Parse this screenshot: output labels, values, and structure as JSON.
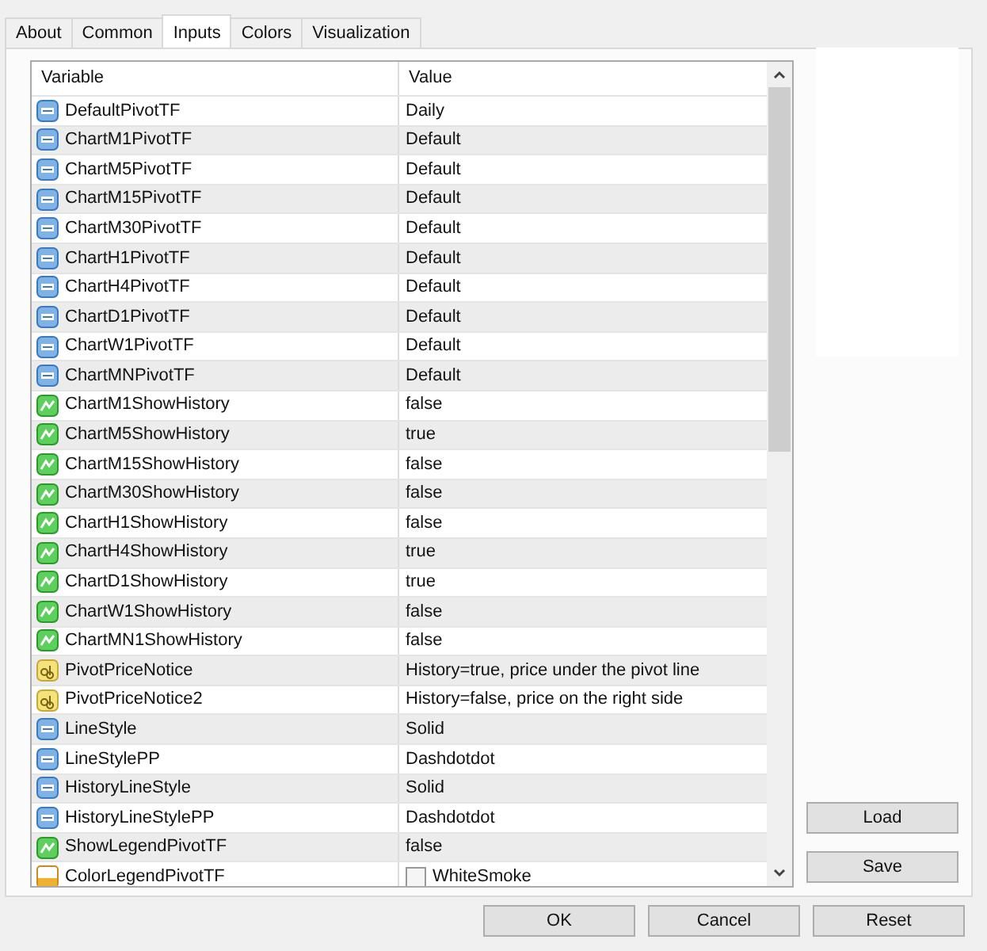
{
  "tabs": [
    {
      "label": "About",
      "selected": false
    },
    {
      "label": "Common",
      "selected": false
    },
    {
      "label": "Inputs",
      "selected": true
    },
    {
      "label": "Colors",
      "selected": false
    },
    {
      "label": "Visualization",
      "selected": false
    }
  ],
  "table": {
    "columns": [
      "Variable",
      "Value"
    ],
    "rows": [
      {
        "kind": "number",
        "variable": "DefaultPivotTF",
        "value": "Daily"
      },
      {
        "kind": "number",
        "variable": "ChartM1PivotTF",
        "value": "Default"
      },
      {
        "kind": "number",
        "variable": "ChartM5PivotTF",
        "value": "Default"
      },
      {
        "kind": "number",
        "variable": "ChartM15PivotTF",
        "value": "Default"
      },
      {
        "kind": "number",
        "variable": "ChartM30PivotTF",
        "value": "Default"
      },
      {
        "kind": "number",
        "variable": "ChartH1PivotTF",
        "value": "Default"
      },
      {
        "kind": "number",
        "variable": "ChartH4PivotTF",
        "value": "Default"
      },
      {
        "kind": "number",
        "variable": "ChartD1PivotTF",
        "value": "Default"
      },
      {
        "kind": "number",
        "variable": "ChartW1PivotTF",
        "value": "Default"
      },
      {
        "kind": "number",
        "variable": "ChartMNPivotTF",
        "value": "Default"
      },
      {
        "kind": "bool",
        "variable": "ChartM1ShowHistory",
        "value": "false"
      },
      {
        "kind": "bool",
        "variable": "ChartM5ShowHistory",
        "value": "true"
      },
      {
        "kind": "bool",
        "variable": "ChartM15ShowHistory",
        "value": "false"
      },
      {
        "kind": "bool",
        "variable": "ChartM30ShowHistory",
        "value": "false"
      },
      {
        "kind": "bool",
        "variable": "ChartH1ShowHistory",
        "value": "false"
      },
      {
        "kind": "bool",
        "variable": "ChartH4ShowHistory",
        "value": "true"
      },
      {
        "kind": "bool",
        "variable": "ChartD1ShowHistory",
        "value": "true"
      },
      {
        "kind": "bool",
        "variable": "ChartW1ShowHistory",
        "value": "false"
      },
      {
        "kind": "bool",
        "variable": "ChartMN1ShowHistory",
        "value": "false"
      },
      {
        "kind": "string",
        "variable": "PivotPriceNotice",
        "value": "History=true, price under the pivot line"
      },
      {
        "kind": "string",
        "variable": "PivotPriceNotice2",
        "value": "History=false, price on the right side"
      },
      {
        "kind": "number",
        "variable": "LineStyle",
        "value": "Solid"
      },
      {
        "kind": "number",
        "variable": "LineStylePP",
        "value": "Dashdotdot"
      },
      {
        "kind": "number",
        "variable": "HistoryLineStyle",
        "value": "Solid"
      },
      {
        "kind": "number",
        "variable": "HistoryLineStylePP",
        "value": "Dashdotdot"
      },
      {
        "kind": "bool",
        "variable": "ShowLegendPivotTF",
        "value": "false"
      },
      {
        "kind": "color",
        "variable": "ColorLegendPivotTF",
        "value": "WhiteSmoke",
        "color": "#f5f5f5"
      }
    ]
  },
  "side_buttons": [
    "Load",
    "Save"
  ],
  "footer_buttons": [
    "OK",
    "Cancel",
    "Reset"
  ]
}
